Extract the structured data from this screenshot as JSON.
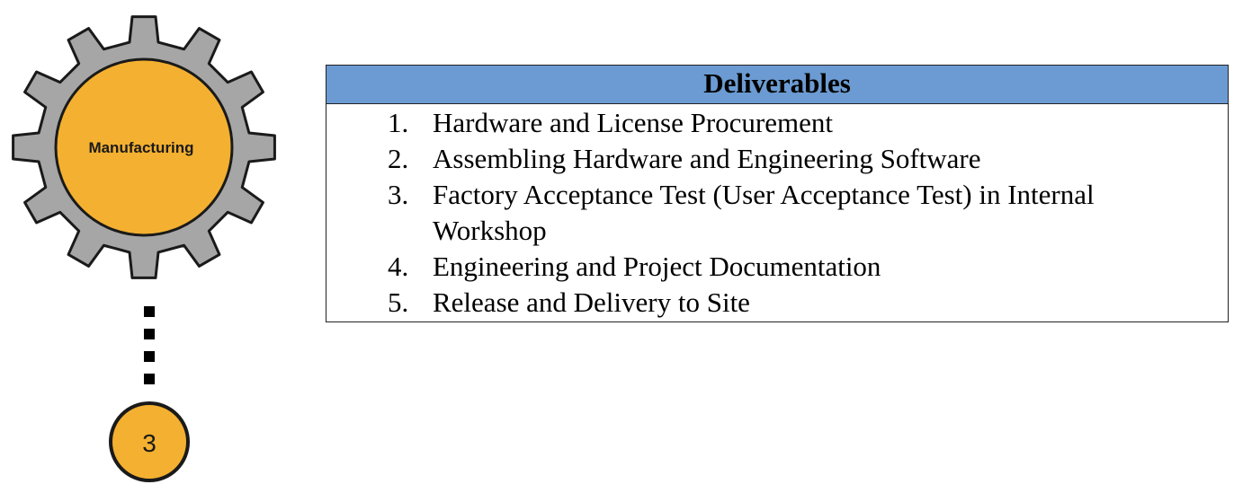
{
  "gear": {
    "label": "Manufacturing",
    "body_color": "#a6a6a6",
    "hub_color": "#f4b030"
  },
  "step": {
    "number": "3",
    "color": "#f4b030"
  },
  "deliverables": {
    "header": "Deliverables",
    "header_color": "#6b9bd2",
    "items": [
      {
        "num": "1.",
        "text": "Hardware and License Procurement"
      },
      {
        "num": "2.",
        "text": "Assembling Hardware and Engineering Software"
      },
      {
        "num": "3.",
        "text": "Factory Acceptance Test (User Acceptance Test) in Internal Workshop"
      },
      {
        "num": "4.",
        "text": "Engineering and Project Documentation"
      },
      {
        "num": "5.",
        "text": "Release and Delivery to Site"
      }
    ]
  }
}
